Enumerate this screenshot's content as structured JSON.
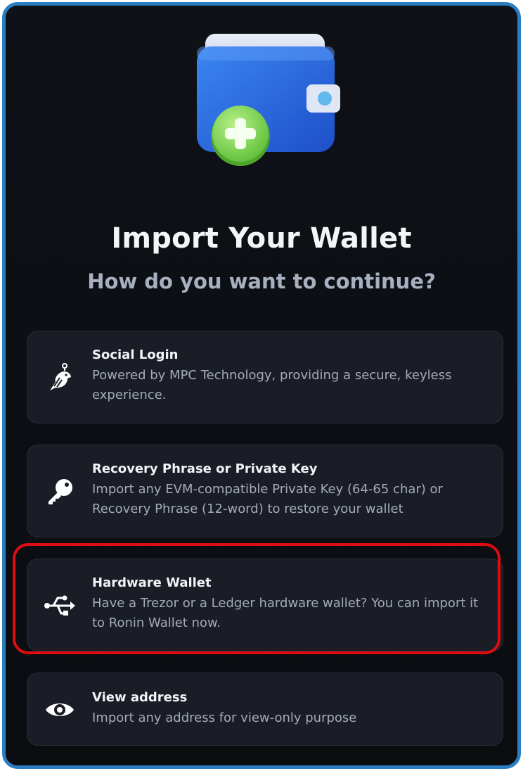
{
  "header": {
    "title": "Import Your Wallet",
    "subtitle": "How do you want to continue?"
  },
  "hero": {
    "icon": "wallet-plus-illustration"
  },
  "options": [
    {
      "label": "Social Login",
      "description": "Powered by MPC Technology, providing a secure, keyless experience.",
      "icon": "ronin-bird-icon"
    },
    {
      "label": "Recovery Phrase or Private Key",
      "description": "Import any EVM-compatible Private Key (64-65 char) or Recovery Phrase (12-word) to restore your wallet",
      "icon": "key-icon"
    },
    {
      "label": "Hardware Wallet",
      "description": "Have a Trezor or a Ledger hardware wallet? You can import it to Ronin Wallet now.",
      "icon": "usb-icon"
    },
    {
      "label": "View address",
      "description": "Import any address for view-only purpose",
      "icon": "eye-icon"
    }
  ],
  "colors": {
    "background": "#0b0d12",
    "card": "#1a1d25",
    "frame_border": "#2a7dc1",
    "highlight": "#e10b12",
    "wallet_blue": "#2f6fe0",
    "plus_green": "#7ed957"
  }
}
